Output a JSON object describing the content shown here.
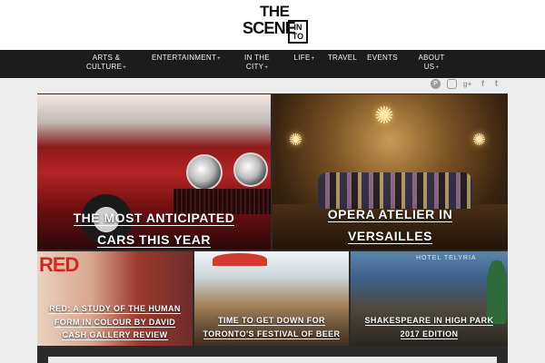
{
  "logo": {
    "line1": "THE",
    "line2": "SCENE",
    "line3": "IN TO"
  },
  "nav": {
    "items": [
      {
        "label": "ARTS &",
        "label2": "CULTURE",
        "dropdown": true
      },
      {
        "label": "ENTERTAINMENT",
        "dropdown": true
      },
      {
        "label": "IN THE",
        "label2": "CITY",
        "dropdown": true
      },
      {
        "label": "LIFE",
        "dropdown": true
      },
      {
        "label": "TRAVEL",
        "dropdown": false
      },
      {
        "label": "EVENTS",
        "dropdown": false
      },
      {
        "label": "ABOUT",
        "label2": "US",
        "dropdown": true
      }
    ],
    "dropdown_glyph": "+"
  },
  "social": {
    "pinterest": "P",
    "instagram": "◎",
    "googleplus": "g+",
    "facebook": "f",
    "twitter": "t"
  },
  "features": {
    "cars": {
      "title_line1": "THE MOST ANTICIPATED",
      "title_line2": "CARS THIS YEAR"
    },
    "opera": {
      "title_line1": "OPERA ATELIER IN",
      "title_line2": "VERSAILLES"
    },
    "red": {
      "overlay_text": "RED",
      "title_line1": "RED: A STUDY OF THE HUMAN",
      "title_line2": "FORM IN COLOUR BY DAVID",
      "title_line3": "CASH GALLERY REVIEW"
    },
    "beer": {
      "title_line1": "TIME TO GET DOWN FOR",
      "title_line2": "TORONTO'S FESTIVAL OF BEER"
    },
    "shakespeare": {
      "sign_text": "HOTEL TELYRIA",
      "title_line1": "SHAKESPEARE IN HIGH PARK",
      "title_line2": "2017 EDITION"
    }
  },
  "colors": {
    "nav_bg": "#1c1c1c",
    "page_bg": "#ececec",
    "content_bg": "#2b2b2b",
    "social_icon": "#9a9a9a"
  }
}
